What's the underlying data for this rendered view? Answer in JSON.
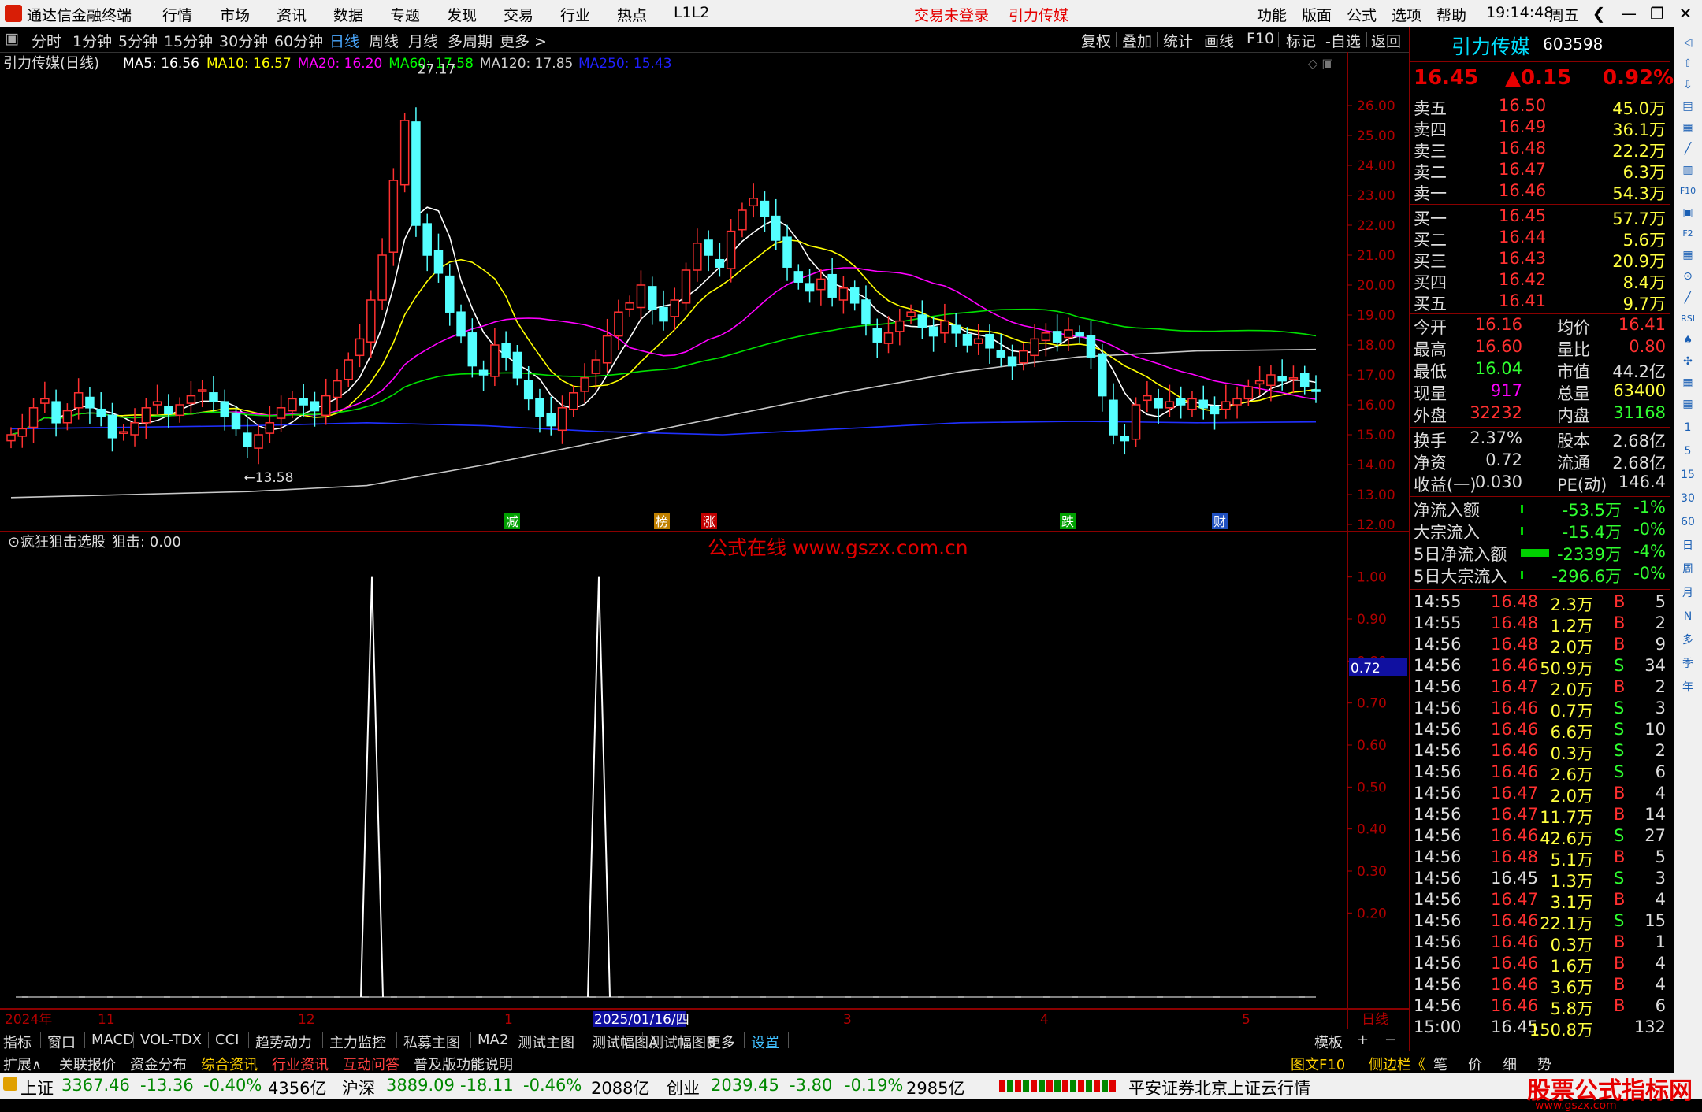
{
  "titlebar": {
    "app_title": "通达信金融终端",
    "menus": [
      "行情",
      "市场",
      "资讯",
      "数据",
      "专题",
      "发现",
      "交易",
      "行业",
      "热点",
      "L1L2"
    ],
    "login_status": "交易未登录",
    "stock_name": "引力传媒",
    "right_menus": [
      "功能",
      "版面",
      "公式",
      "选项",
      "帮助"
    ],
    "time": "19:14:48",
    "weekday": "周五",
    "window_buttons": [
      "❮",
      "—",
      "❐",
      "✕"
    ]
  },
  "toolbar": {
    "periods": [
      "分时",
      "1分钟",
      "5分钟",
      "15分钟",
      "30分钟",
      "60分钟",
      "日线",
      "周线",
      "月线",
      "多周期",
      "更多 >"
    ],
    "active_period": "日线",
    "right_buttons": [
      "复权",
      "叠加",
      "统计",
      "画线",
      "F10",
      "标记",
      "-自选",
      "返回"
    ]
  },
  "main_chart": {
    "title": "引力传媒(日线)",
    "ma_legend": [
      {
        "label": "MA5: 16.56",
        "color": "#ffffff"
      },
      {
        "label": "MA10: 16.57",
        "color": "#ffff00"
      },
      {
        "label": "MA20: 16.20",
        "color": "#ff00ff"
      },
      {
        "label": "MA60: 17.58",
        "color": "#00ff00"
      },
      {
        "label": "MA120: 17.85",
        "color": "#d0d0d0"
      },
      {
        "label": "MA250: 15.43",
        "color": "#2020ff"
      }
    ],
    "high_label": "27.17",
    "low_label": "13.58",
    "y_ticks": [
      "26.00",
      "25.00",
      "24.00",
      "23.00",
      "22.00",
      "21.00",
      "20.00",
      "19.00",
      "18.00",
      "17.00",
      "16.00",
      "15.00",
      "14.00",
      "13.00",
      "12.00"
    ],
    "markers": [
      {
        "text": "减",
        "bg": "#00a000"
      },
      {
        "text": "榜",
        "bg": "#c08000"
      },
      {
        "text": "涨",
        "bg": "#c00000"
      },
      {
        "text": "跌",
        "bg": "#00a000"
      },
      {
        "text": "财",
        "bg": "#2050c0"
      }
    ]
  },
  "chart_data": {
    "type": "candlestick",
    "ylim": [
      12,
      27
    ],
    "ma_values": {
      "MA5": 16.56,
      "MA10": 16.57,
      "MA20": 16.2,
      "MA60": 17.58,
      "MA120": 17.85,
      "MA250": 15.43
    },
    "closes": [
      15.0,
      15.2,
      15.9,
      16.2,
      15.4,
      15.8,
      16.4,
      15.9,
      15.6,
      14.9,
      15.1,
      15.4,
      15.9,
      16.1,
      15.7,
      16.0,
      16.3,
      16.5,
      16.1,
      15.6,
      15.2,
      14.6,
      15.0,
      15.4,
      15.9,
      16.2,
      16.0,
      15.8,
      16.3,
      16.8,
      17.5,
      18.2,
      19.5,
      21.0,
      23.5,
      25.5,
      22.0,
      21.0,
      20.4,
      19.1,
      18.3,
      17.3,
      17.0,
      18.0,
      17.6,
      16.9,
      16.2,
      15.6,
      15.3,
      15.9,
      16.4,
      16.9,
      17.5,
      18.3,
      19.1,
      19.4,
      20.0,
      19.2,
      18.8,
      19.5,
      20.5,
      21.4,
      21.0,
      20.6,
      21.8,
      22.5,
      22.9,
      22.3,
      21.5,
      20.6,
      20.1,
      19.8,
      20.2,
      19.6,
      19.9,
      19.4,
      18.7,
      18.1,
      18.4,
      18.8,
      19.1,
      18.6,
      18.3,
      18.8,
      18.4,
      18.0,
      18.2,
      17.9,
      17.6,
      17.3,
      17.8,
      18.2,
      18.4,
      18.1,
      18.5,
      18.3,
      17.6,
      16.3,
      15.0,
      14.8,
      16.0,
      16.3,
      15.9,
      16.1,
      16.0,
      16.2,
      15.9,
      15.7,
      16.1,
      16.2,
      16.6,
      16.8,
      17.0,
      16.8,
      16.9,
      16.6,
      16.45
    ],
    "indicator": {
      "name": "疯狂狙击选股",
      "series": "狙击",
      "current_value": "0.00",
      "spikes": [
        1.0,
        1.0
      ],
      "y_ticks": [
        "1.00",
        "0.90",
        "0.80",
        "0.70",
        "0.60",
        "0.50",
        "0.40",
        "0.30",
        "0.20"
      ],
      "cursor_value": "0.72"
    },
    "x_ticks": [
      "2024年",
      "11",
      "12",
      "1",
      "2025/01/16/四",
      "3",
      "4",
      "5",
      "日线"
    ]
  },
  "watermark": "公式在线  www.gszx.com.cn",
  "quote": {
    "name": "引力传媒",
    "code": "603598",
    "price": "16.45",
    "change": "▲0.15",
    "pct": "0.92%",
    "asks": [
      {
        "label": "卖五",
        "price": "16.50",
        "vol": "45.0万"
      },
      {
        "label": "卖四",
        "price": "16.49",
        "vol": "36.1万"
      },
      {
        "label": "卖三",
        "price": "16.48",
        "vol": "22.2万"
      },
      {
        "label": "卖二",
        "price": "16.47",
        "vol": "6.3万"
      },
      {
        "label": "卖一",
        "price": "16.46",
        "vol": "54.3万"
      }
    ],
    "bids": [
      {
        "label": "买一",
        "price": "16.45",
        "vol": "57.7万"
      },
      {
        "label": "买二",
        "price": "16.44",
        "vol": "5.6万"
      },
      {
        "label": "买三",
        "price": "16.43",
        "vol": "20.9万"
      },
      {
        "label": "买四",
        "price": "16.42",
        "vol": "8.4万"
      },
      {
        "label": "买五",
        "price": "16.41",
        "vol": "9.7万"
      }
    ],
    "stats": [
      [
        "今开",
        "16.16",
        "均价",
        "16.41"
      ],
      [
        "最高",
        "16.60",
        "量比",
        "0.80"
      ],
      [
        "最低",
        "16.04",
        "市值",
        "44.2亿"
      ],
      [
        "现量",
        "917",
        "总量",
        "63400"
      ],
      [
        "外盘",
        "32232",
        "内盘",
        "31168"
      ]
    ],
    "stats2": [
      [
        "换手",
        "2.37%",
        "股本",
        "2.68亿"
      ],
      [
        "净资",
        "0.72",
        "流通",
        "2.68亿"
      ],
      [
        "收益(一)",
        "0.030",
        "PE(动)",
        "146.4"
      ]
    ],
    "flows": [
      [
        "净流入额",
        "-53.5万",
        "-1%"
      ],
      [
        "大宗流入",
        "-15.4万",
        "-0%"
      ],
      [
        "5日净流入额",
        "-2339万",
        "-4%"
      ],
      [
        "5日大宗流入",
        "-296.6万",
        "-0%"
      ]
    ],
    "ticks": [
      [
        "14:55",
        "16.48",
        "2.3万",
        "B",
        "5"
      ],
      [
        "14:55",
        "16.48",
        "1.2万",
        "B",
        "2"
      ],
      [
        "14:56",
        "16.48",
        "2.0万",
        "B",
        "9"
      ],
      [
        "14:56",
        "16.46",
        "50.9万",
        "S",
        "34"
      ],
      [
        "14:56",
        "16.47",
        "2.0万",
        "B",
        "2"
      ],
      [
        "14:56",
        "16.46",
        "0.7万",
        "S",
        "3"
      ],
      [
        "14:56",
        "16.46",
        "6.6万",
        "S",
        "10"
      ],
      [
        "14:56",
        "16.46",
        "0.3万",
        "S",
        "2"
      ],
      [
        "14:56",
        "16.46",
        "2.6万",
        "S",
        "6"
      ],
      [
        "14:56",
        "16.47",
        "2.0万",
        "B",
        "4"
      ],
      [
        "14:56",
        "16.47",
        "11.7万",
        "B",
        "14"
      ],
      [
        "14:56",
        "16.46",
        "42.6万",
        "S",
        "27"
      ],
      [
        "14:56",
        "16.48",
        "5.1万",
        "B",
        "5"
      ],
      [
        "14:56",
        "16.45",
        "1.3万",
        "S",
        "3"
      ],
      [
        "14:56",
        "16.47",
        "3.1万",
        "B",
        "4"
      ],
      [
        "14:56",
        "16.46",
        "22.1万",
        "S",
        "15"
      ],
      [
        "14:56",
        "16.46",
        "0.3万",
        "B",
        "1"
      ],
      [
        "14:56",
        "16.46",
        "1.6万",
        "B",
        "4"
      ],
      [
        "14:56",
        "16.46",
        "3.6万",
        "B",
        "4"
      ],
      [
        "14:56",
        "16.46",
        "5.8万",
        "B",
        "6"
      ],
      [
        "15:00",
        "16.45",
        "150.8万",
        "",
        "132"
      ]
    ]
  },
  "sidebar_icons": [
    "◁",
    "⇧",
    "⇩",
    "▤",
    "▦",
    "╱",
    "▥",
    "F10",
    "▣",
    "F2",
    "▦",
    "⊙",
    "╱",
    "RSI",
    "♠",
    "✣",
    "▦",
    "▦",
    "1",
    "5",
    "15",
    "30",
    "60",
    "日",
    "周",
    "月",
    "N",
    "多",
    "季",
    "年"
  ],
  "bottom_tabs": [
    "指标",
    "窗口",
    "MACD",
    "VOL-TDX",
    "CCI",
    "趋势动力",
    "主力监控",
    "私募主图",
    "MA2",
    "测试主图",
    "测试幅图A",
    "测试幅图B",
    "更多",
    "设置"
  ],
  "bottom_tabs_right": [
    "模板",
    "+",
    "−"
  ],
  "bottom_tabs2": [
    "扩展∧",
    "关联报价",
    "资金分布",
    "综合资讯",
    "行业资讯",
    "互动问答",
    "普及版功能说明"
  ],
  "bottom_tabs2_right": [
    "图文F10",
    "侧边栏《",
    "笔",
    "价",
    "细",
    "势"
  ],
  "statusbar": {
    "sh_name": "上证",
    "sh_val": "3367.46",
    "sh_chg": "-13.36",
    "sh_pct": "-0.40%",
    "sh_amt": "4356亿",
    "hs_name": "沪深",
    "hs_val": "3889.09",
    "hs_chg": "-18.11",
    "hs_pct": "-0.46%",
    "hs_amt": "2088亿",
    "cy_name": "创业",
    "cy_val": "2039.45",
    "cy_chg": "-3.80",
    "cy_pct": "-0.19%",
    "cy_amt": "2985亿",
    "server": "平安证券北京上证云行情",
    "brand": "股票公式指标网",
    "brand_url": "www.gszx.com"
  }
}
